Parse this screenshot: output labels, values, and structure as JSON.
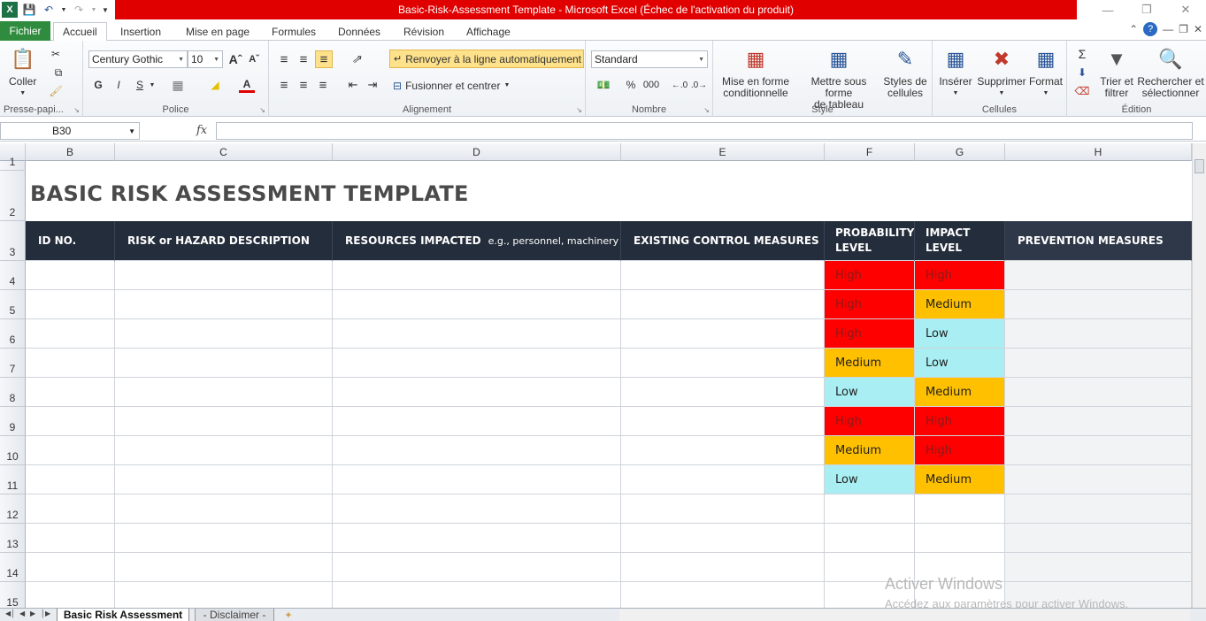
{
  "window": {
    "title": "Basic-Risk-Assessment Template  -  Microsoft Excel (Échec de l'activation du produit)"
  },
  "ribbon_tabs": [
    "Fichier",
    "Accueil",
    "Insertion",
    "Mise en page",
    "Formules",
    "Données",
    "Révision",
    "Affichage"
  ],
  "ribbon": {
    "clipboard": {
      "paste": "Coller",
      "label": "Presse-papi..."
    },
    "font": {
      "name": "Century Gothic",
      "size": "10",
      "bold": "G",
      "italic": "I",
      "underline": "S",
      "label": "Police"
    },
    "alignment": {
      "wrap": "Renvoyer à la ligne automatiquement",
      "merge": "Fusionner et centrer",
      "label": "Alignement"
    },
    "number": {
      "format": "Standard",
      "percent": "%",
      "thousands": "000",
      "label": "Nombre"
    },
    "style": {
      "conditional": [
        "Mise en forme",
        "conditionnelle"
      ],
      "table": [
        "Mettre sous forme",
        "de tableau"
      ],
      "cell_styles": [
        "Styles de",
        "cellules"
      ],
      "label": "Style"
    },
    "cells": {
      "insert": "Insérer",
      "delete": "Supprimer",
      "format": "Format",
      "label": "Cellules"
    },
    "editing": {
      "sort": [
        "Trier et",
        "filtrer"
      ],
      "find": [
        "Rechercher et",
        "sélectionner"
      ],
      "label": "Édition"
    }
  },
  "formula_bar": {
    "name_box": "B30",
    "fx": "fx",
    "value": ""
  },
  "columns": [
    "B",
    "C",
    "D",
    "E",
    "F",
    "G",
    "H"
  ],
  "rows": [
    "1",
    "2",
    "3",
    "4",
    "5",
    "6",
    "7",
    "8",
    "9",
    "10",
    "11",
    "12",
    "13",
    "14",
    "15"
  ],
  "sheet_title": "BASIC RISK ASSESSMENT TEMPLATE",
  "table_headers": {
    "id": "ID NO.",
    "risk": "RISK or HAZARD DESCRIPTION",
    "resources": "RESOURCES IMPACTED",
    "resources_hint": "e.g., personnel, machinery",
    "controls": "EXISTING CONTROL MEASURES",
    "probability": [
      "PROBABILITY",
      "LEVEL"
    ],
    "impact": [
      "IMPACT",
      "LEVEL"
    ],
    "prevention": "PREVENTION MEASURES"
  },
  "levels": [
    {
      "probability": "High",
      "impact": "High"
    },
    {
      "probability": "High",
      "impact": "Medium"
    },
    {
      "probability": "High",
      "impact": "Low"
    },
    {
      "probability": "Medium",
      "impact": "Low"
    },
    {
      "probability": "Low",
      "impact": "Medium"
    },
    {
      "probability": "High",
      "impact": "High"
    },
    {
      "probability": "Medium",
      "impact": "High"
    },
    {
      "probability": "Low",
      "impact": "Medium"
    }
  ],
  "colors": {
    "high": "#ff0000",
    "medium": "#ffc000",
    "low": "#a8eef2",
    "header": "#242d3b",
    "title_bar": "#e00000",
    "file_tab": "#2f8c3e"
  },
  "sheet_tabs": [
    "Basic Risk Assessment",
    "- Disclaimer -"
  ],
  "watermark": {
    "line1": "Activer Windows",
    "line2": "Accédez aux paramètres pour activer Windows."
  }
}
